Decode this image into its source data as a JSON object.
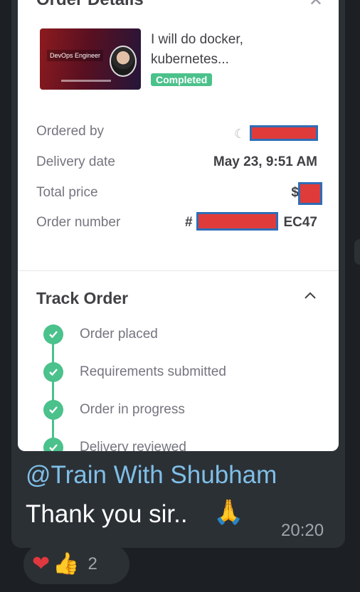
{
  "card": {
    "title": "Order Details",
    "gig": {
      "title": "I will do docker, kubernetes...",
      "thumbnail_label": "DevOps Engineer",
      "status": "Completed"
    },
    "details": [
      {
        "label": "Ordered by",
        "value": ""
      },
      {
        "label": "Delivery date",
        "value": "May 23, 9:51 AM"
      },
      {
        "label": "Total price",
        "value": "$"
      },
      {
        "label": "Order number",
        "value_prefix": "#",
        "value_suffix": "EC47"
      }
    ],
    "track": {
      "title": "Track Order",
      "steps": [
        {
          "label": "Order placed"
        },
        {
          "label": "Requirements submitted"
        },
        {
          "label": "Order in progress"
        },
        {
          "label": "Delivery reviewed"
        }
      ]
    }
  },
  "message": {
    "mention": "@Train With Shubham",
    "text": "Thank you sir..",
    "time": "20:20"
  },
  "reactions": {
    "count": "2"
  },
  "colors": {
    "accent_green": "#4bc18b",
    "redaction": "#e03b3b",
    "mention_blue": "#7fbfe8"
  }
}
